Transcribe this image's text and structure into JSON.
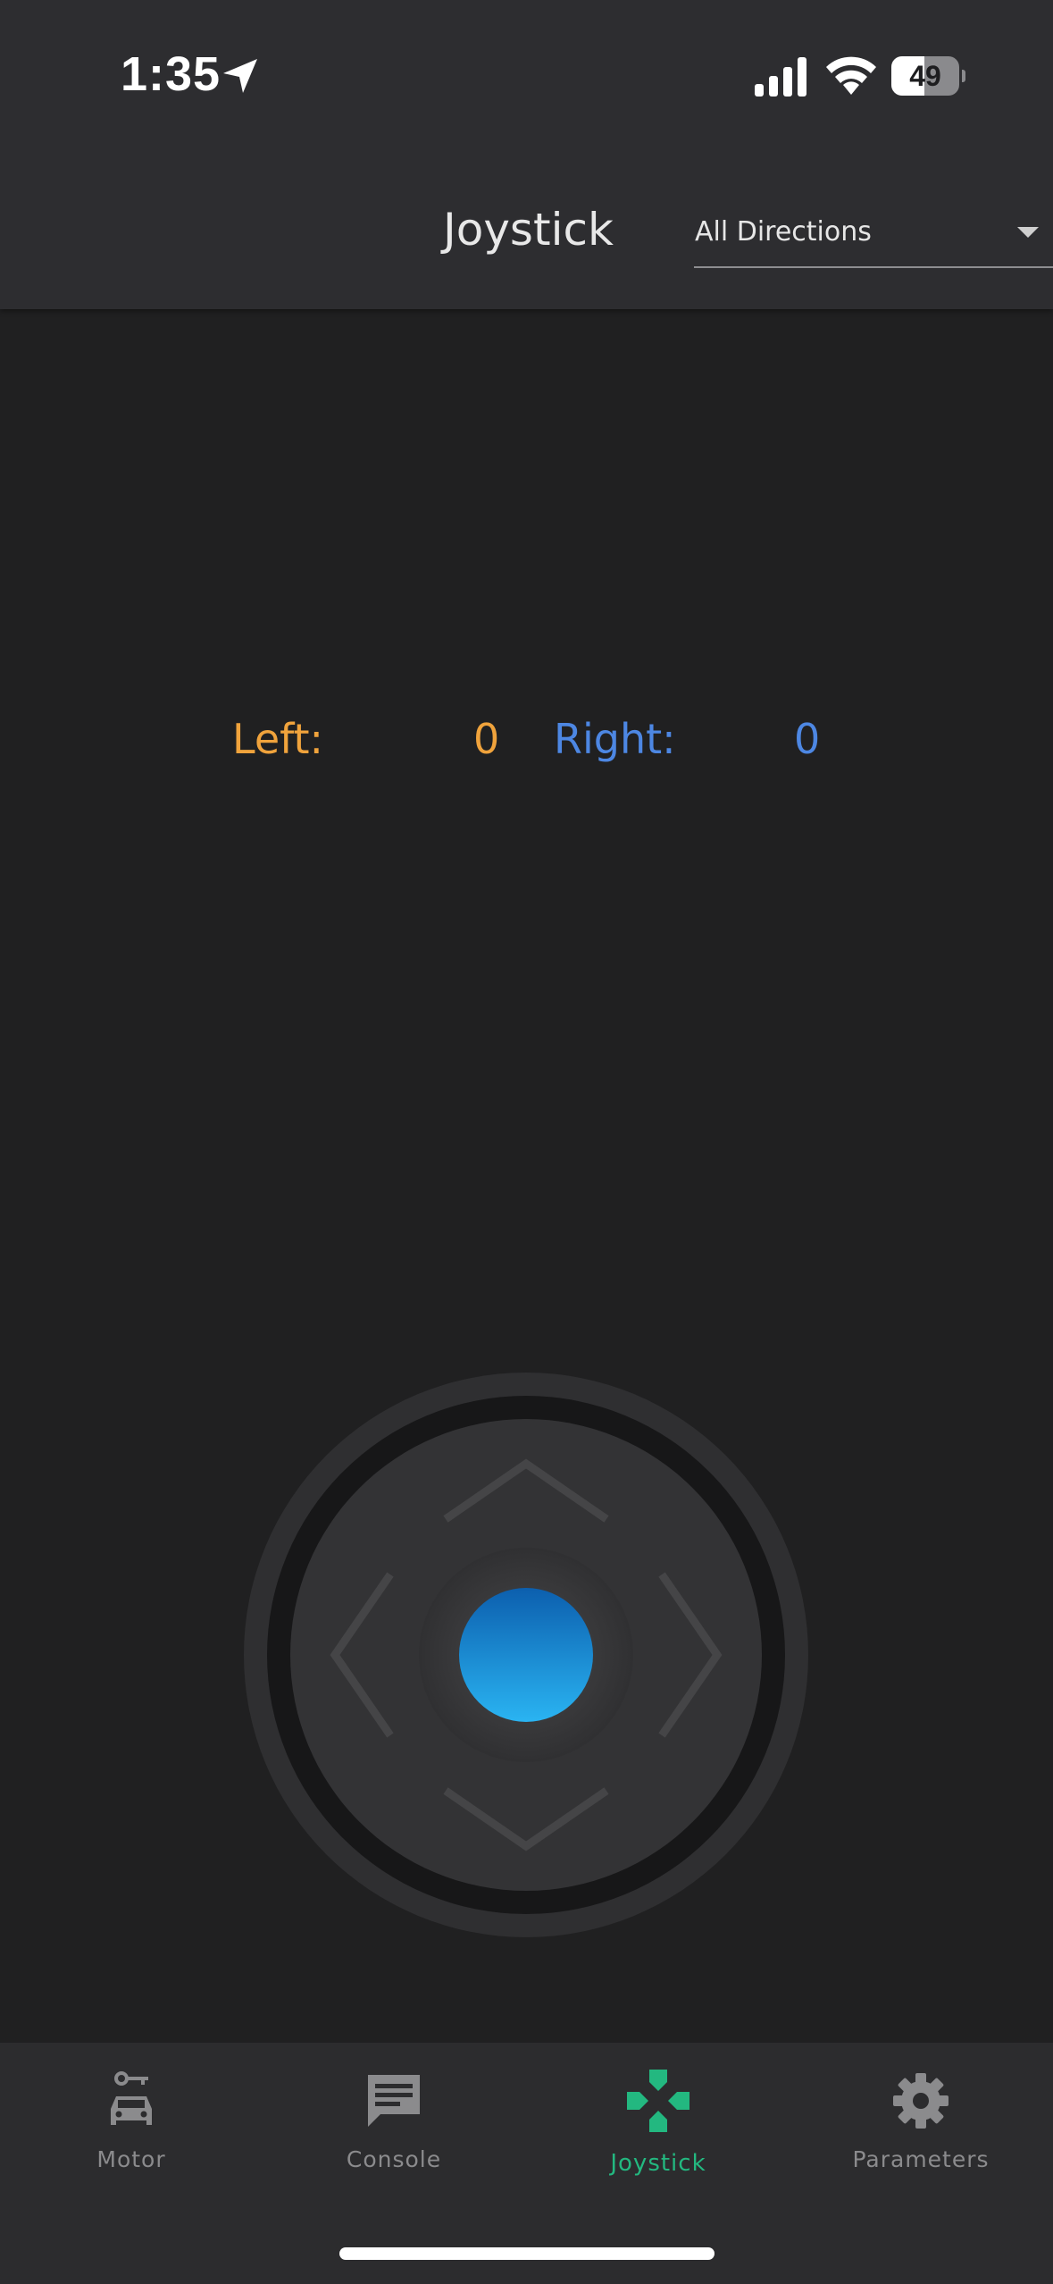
{
  "status_bar": {
    "time": "1:35",
    "battery_level": "49"
  },
  "app_bar": {
    "title": "Joystick",
    "direction_select": {
      "selected": "All Directions"
    }
  },
  "readout": {
    "left_label": "Left:",
    "left_value": "0",
    "right_label": "Right:",
    "right_value": "0",
    "left_color": "#f0a33c",
    "right_color": "#4d87e3"
  },
  "joystick": {
    "knob_color": "#1e9ee6",
    "direction_icons": [
      "chevron-up-icon",
      "chevron-down-icon",
      "chevron-left-icon",
      "chevron-right-icon"
    ]
  },
  "bottom_nav": {
    "active_color": "#23b880",
    "items": [
      {
        "label": "Motor",
        "icon": "car-key-icon",
        "active": false
      },
      {
        "label": "Console",
        "icon": "message-icon",
        "active": false
      },
      {
        "label": "Joystick",
        "icon": "gamepad-icon",
        "active": true
      },
      {
        "label": "Parameters",
        "icon": "gear-icon",
        "active": false
      }
    ]
  }
}
